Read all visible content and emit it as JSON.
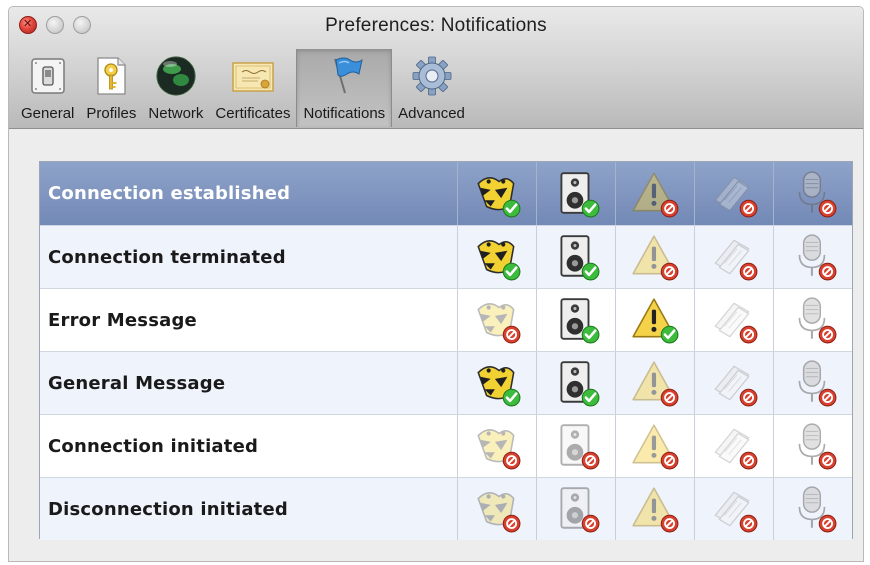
{
  "window": {
    "title": "Preferences: Notifications"
  },
  "toolbar": {
    "items": [
      {
        "label": "General",
        "icon": "switch-icon",
        "selected": false
      },
      {
        "label": "Profiles",
        "icon": "profile-key-icon",
        "selected": false
      },
      {
        "label": "Network",
        "icon": "network-globe-icon",
        "selected": false
      },
      {
        "label": "Certificates",
        "icon": "certificate-icon",
        "selected": false
      },
      {
        "label": "Notifications",
        "icon": "flag-icon",
        "selected": true
      },
      {
        "label": "Advanced",
        "icon": "gear-icon",
        "selected": false
      }
    ]
  },
  "notifications": {
    "columns": [
      "growl",
      "sound",
      "alert",
      "log",
      "speech"
    ],
    "rows": [
      {
        "label": "Connection established",
        "selected": true,
        "enabled": [
          true,
          true,
          false,
          false,
          false
        ]
      },
      {
        "label": "Connection terminated",
        "selected": false,
        "enabled": [
          true,
          true,
          false,
          false,
          false
        ]
      },
      {
        "label": "Error Message",
        "selected": false,
        "enabled": [
          false,
          true,
          true,
          false,
          false
        ]
      },
      {
        "label": "General Message",
        "selected": false,
        "enabled": [
          true,
          true,
          false,
          false,
          false
        ]
      },
      {
        "label": "Connection initiated",
        "selected": false,
        "enabled": [
          false,
          false,
          false,
          false,
          false
        ]
      },
      {
        "label": "Disconnection initiated",
        "selected": false,
        "enabled": [
          false,
          false,
          false,
          false,
          false
        ]
      }
    ]
  },
  "colors": {
    "selected_row": "#7f95c0",
    "check_badge": "#3dbb3d",
    "no_badge": "#d9412f"
  }
}
